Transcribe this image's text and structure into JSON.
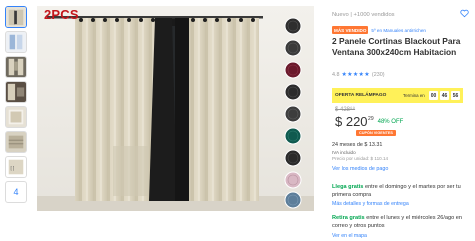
{
  "gallery": {
    "badge_text": "2PCS",
    "thumbnail_more_count": "4",
    "main_image_alt": "Cortinas blackout beige con ollaos en ventana",
    "swatch_colors": [
      "#2e2e2e",
      "#3a3a3a",
      "#6b1a2c",
      "#2b2b2b",
      "#3d3d3d",
      "#0f5a4f",
      "#2a2a2a",
      "#d9b8c4",
      "#5d7e9a"
    ]
  },
  "header": {
    "condition_sales": "Nuevo  |  +1000 vendidos"
  },
  "badges": {
    "best_seller": "MÁS VENDIDO",
    "category_link": "5º en Manuales antirrichen"
  },
  "product": {
    "title": "2 Panele Cortinas Blackout Para Ventana 300x240cm Habitacion",
    "rating_value": "4.8",
    "stars": "★★★★★",
    "review_count": "(230)"
  },
  "flash_sale": {
    "label": "OFERTA RELÁMPAGO",
    "timer_label": "Termina en",
    "hours": "00",
    "minutes": "46",
    "seconds": "56"
  },
  "price": {
    "original": "$ 428⁸⁸",
    "current": "$ 220",
    "cents": "29",
    "discount": "48% OFF",
    "discount_tag": "CUPÓN VIGENTES",
    "installments": "24 meses de $ 13.31",
    "tax": "IVA incluido",
    "unit_price": "Precio por unidad: $ 110.14"
  },
  "links": {
    "payment_methods": "Ver los medios de pago",
    "shipping_options": "Más detalles y formas de entrega",
    "map": "Ver en el mapa"
  },
  "shipping": {
    "free_label": "Llega gratis",
    "free_text": " entre el domingo y el martes por ser tu primera compra",
    "pickup_label": "Retira gratis",
    "pickup_text": " entre el lunes y el miércoles 26/ago en correo y otros puntos"
  }
}
